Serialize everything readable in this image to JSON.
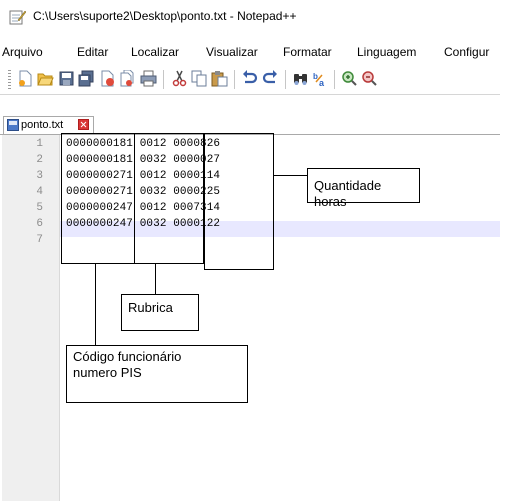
{
  "window": {
    "title": "C:\\Users\\suporte2\\Desktop\\ponto.txt - Notepad++"
  },
  "menu": [
    "Arquivo",
    "Editar",
    "Localizar",
    "Visualizar",
    "Formatar",
    "Linguagem",
    "Configur"
  ],
  "toolbar_icons": [
    "new-file-icon",
    "open-folder-icon",
    "save-icon",
    "save-all-icon",
    "close-icon",
    "close-all-icon",
    "print-icon",
    "cut-icon",
    "copy-icon",
    "paste-icon",
    "undo-icon",
    "redo-icon",
    "find-icon",
    "replace-icon",
    "zoom-in-icon",
    "zoom-out-icon"
  ],
  "tab": {
    "label": "ponto.txt"
  },
  "editor": {
    "lines": [
      {
        "num": "1",
        "text": "0000000181 0012 0000826"
      },
      {
        "num": "2",
        "text": "0000000181 0032 0000027"
      },
      {
        "num": "3",
        "text": "0000000271 0012 0000114"
      },
      {
        "num": "4",
        "text": "0000000271 0032 0000225"
      },
      {
        "num": "5",
        "text": "0000000247 0012 0007314"
      },
      {
        "num": "6",
        "text": "0000000247 0032 0000122"
      },
      {
        "num": "7",
        "text": ""
      }
    ],
    "current_line": 5
  },
  "callouts": {
    "horas": "Quantidade horas",
    "rubrica": "Rubrica",
    "codigo_line1": "Código funcionário",
    "codigo_line2": "numero PIS"
  },
  "colors": {
    "current_line": "#e8e8ff",
    "gutter": "#efefef",
    "close_button": "#d93636"
  }
}
